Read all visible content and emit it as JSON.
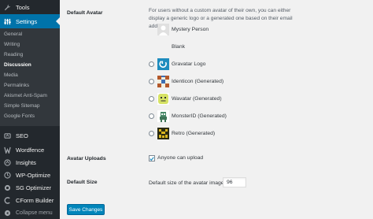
{
  "sidebar": {
    "top_items": [
      {
        "label": "Tools",
        "icon": "wrench-icon"
      },
      {
        "label": "Settings",
        "icon": "settings-sliders-icon"
      }
    ],
    "submenu": [
      "General",
      "Writing",
      "Reading",
      "Discussion",
      "Media",
      "Permalinks",
      "Akismet Anti-Spam",
      "Simple Sitemap",
      "Google Fonts"
    ],
    "active_submenu": "Discussion",
    "plugins": [
      {
        "label": "SEO",
        "icon": "seo-icon"
      },
      {
        "label": "Wordfence",
        "icon": "wordfence-icon"
      },
      {
        "label": "Insights",
        "icon": "insights-icon"
      },
      {
        "label": "WP-Optimize",
        "icon": "wp-optimize-icon"
      },
      {
        "label": "SG Optimizer",
        "icon": "sg-optimizer-icon"
      },
      {
        "label": "CForm Builder",
        "icon": "cform-builder-icon"
      },
      {
        "label": "Collapse menu",
        "icon": "collapse-icon"
      }
    ]
  },
  "settings": {
    "default_avatar": {
      "heading": "Default Avatar",
      "description": "For users without a custom avatar of their own, you can either display a generic logo or a generated one based on their email address.",
      "options": [
        {
          "label": "Mystery Person",
          "icon": "mystery-person-avatar",
          "has_radio": false
        },
        {
          "label": "Blank",
          "icon": "blank-avatar",
          "has_radio": false
        },
        {
          "label": "Gravatar Logo",
          "icon": "gravatar-logo-avatar",
          "has_radio": true
        },
        {
          "label": "Identicon (Generated)",
          "icon": "identicon-avatar",
          "has_radio": true
        },
        {
          "label": "Wavatar (Generated)",
          "icon": "wavatar-avatar",
          "has_radio": true
        },
        {
          "label": "MonsterID (Generated)",
          "icon": "monsterid-avatar",
          "has_radio": true
        },
        {
          "label": "Retro (Generated)",
          "icon": "retro-avatar",
          "has_radio": true
        }
      ]
    },
    "avatar_uploads": {
      "heading": "Avatar Uploads",
      "checkbox_label": "Anyone can upload",
      "checked": true
    },
    "default_size": {
      "heading": "Default Size",
      "label": "Default size of the avatar image",
      "value": "96"
    }
  },
  "save_button": "Save Changes",
  "colors": {
    "sidebar_bg": "#23282d",
    "submenu_bg": "#32373c",
    "accent": "#0073aa",
    "button": "#0085ba"
  }
}
